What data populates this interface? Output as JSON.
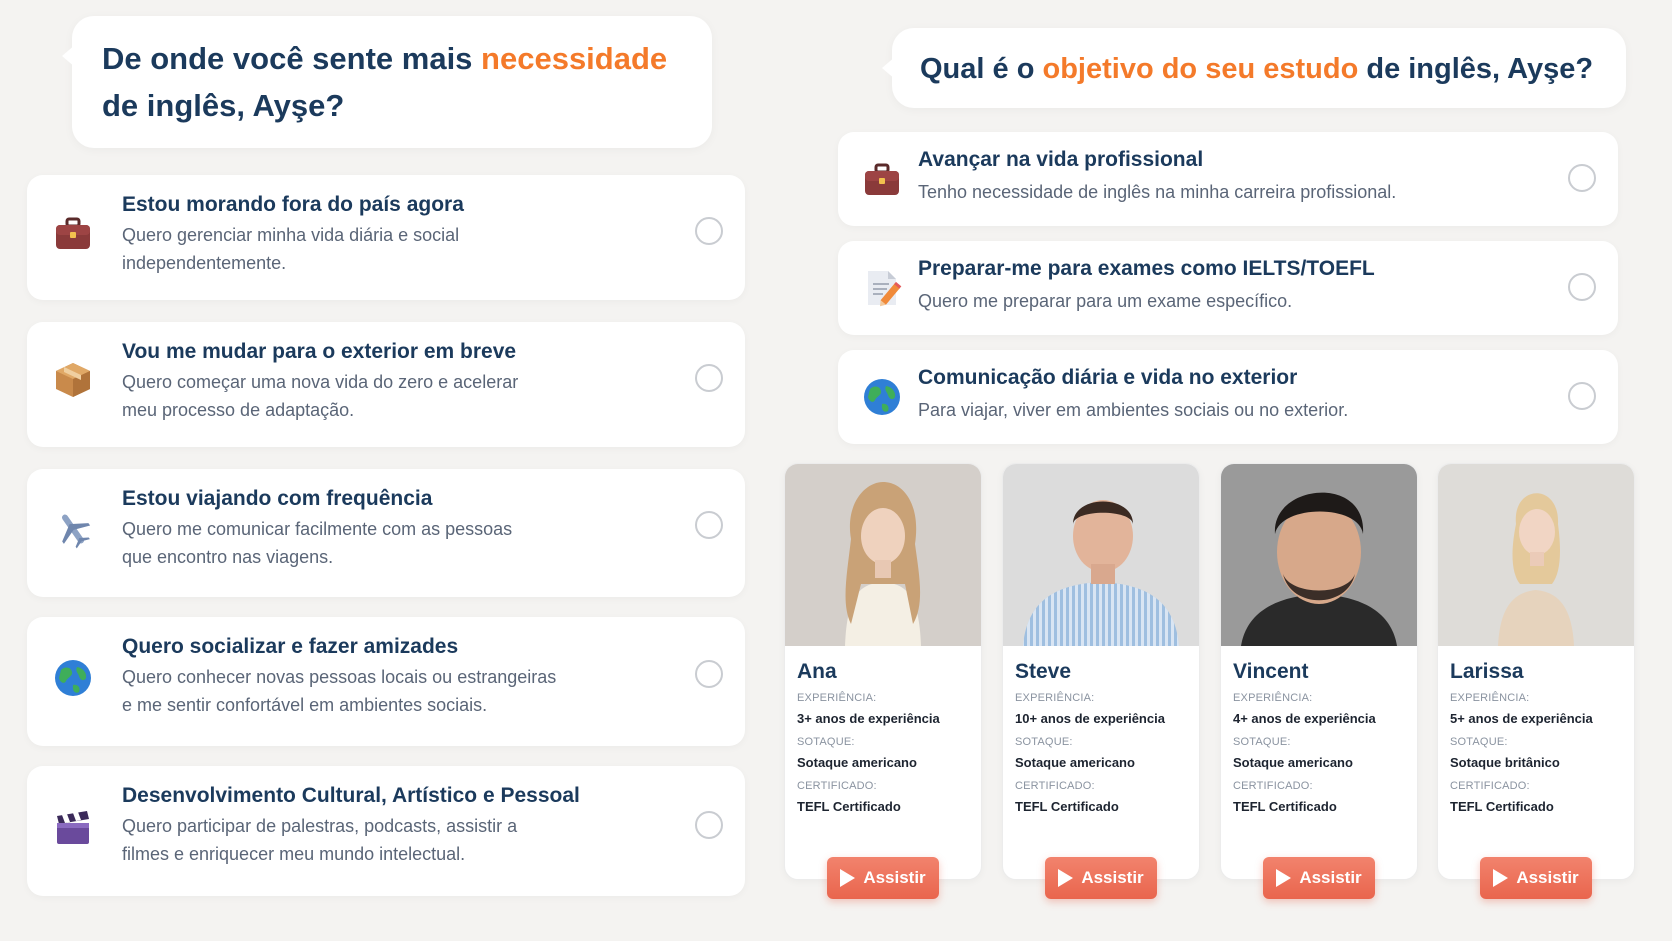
{
  "question1": {
    "prefix": "De onde você sente mais ",
    "highlight": "necessidade",
    "suffix": "de inglês, Ayşe?"
  },
  "question2": {
    "prefix": "Qual é o ",
    "highlight": "objetivo do seu estudo",
    "suffix": " de inglês, Ayşe?"
  },
  "left_options": [
    {
      "title": "Estou morando fora do país agora",
      "desc_line1": "Quero gerenciar minha vida diária e social",
      "desc_line2": "independentemente.",
      "icon": "briefcase-icon"
    },
    {
      "title": "Vou me mudar para o exterior em breve",
      "desc_line1": "Quero começar uma nova vida do zero e acelerar",
      "desc_line2": "meu processo de adaptação.",
      "icon": "box-icon"
    },
    {
      "title": "Estou viajando com frequência",
      "desc_line1": "Quero me comunicar facilmente com as pessoas",
      "desc_line2": "que encontro nas viagens.",
      "icon": "airplane-icon"
    },
    {
      "title": "Quero socializar e fazer amizades",
      "desc_line1": "Quero conhecer novas pessoas locais ou estrangeiras",
      "desc_line2": "e me sentir confortável em ambientes sociais.",
      "icon": "globe-icon"
    },
    {
      "title": "Desenvolvimento Cultural, Artístico e Pessoal",
      "desc_line1": "Quero participar de palestras, podcasts, assistir a",
      "desc_line2": "filmes e enriquecer meu mundo intelectual.",
      "icon": "clapperboard-icon"
    }
  ],
  "right_options": [
    {
      "title": "Avançar na vida profissional",
      "desc": "Tenho necessidade de inglês na minha carreira profissional.",
      "icon": "briefcase-icon"
    },
    {
      "title": "Preparar-me para exames como IELTS/TOEFL",
      "desc": "Quero me preparar para um exame específico.",
      "icon": "document-pencil-icon"
    },
    {
      "title": "Comunicação diária e vida no exterior",
      "desc": "Para viajar, viver em ambientes sociais ou no exterior.",
      "icon": "globe-icon"
    }
  ],
  "labels": {
    "experience": "EXPERIÊNCIA:",
    "accent": "SOTAQUE:",
    "certified": "CERTIFICADO:",
    "watch": "Assistir"
  },
  "teachers": [
    {
      "name": "Ana",
      "experience": "3+ anos de experiência",
      "accent": "Sotaque americano",
      "certificate": "TEFL Certificado"
    },
    {
      "name": "Steve",
      "experience": "10+ anos de experiência",
      "accent": "Sotaque americano",
      "certificate": "TEFL Certificado"
    },
    {
      "name": "Vincent",
      "experience": "4+ anos de experiência",
      "accent": "Sotaque americano",
      "certificate": "TEFL Certificado"
    },
    {
      "name": "Larissa",
      "experience": "5+ anos de experiência",
      "accent": "Sotaque britânico",
      "certificate": "TEFL Certificado"
    }
  ],
  "colors": {
    "accent_orange": "#f47a2a",
    "title_navy": "#1b3a5c",
    "button_coral": "#e9654d",
    "background": "#f4f3f1"
  }
}
